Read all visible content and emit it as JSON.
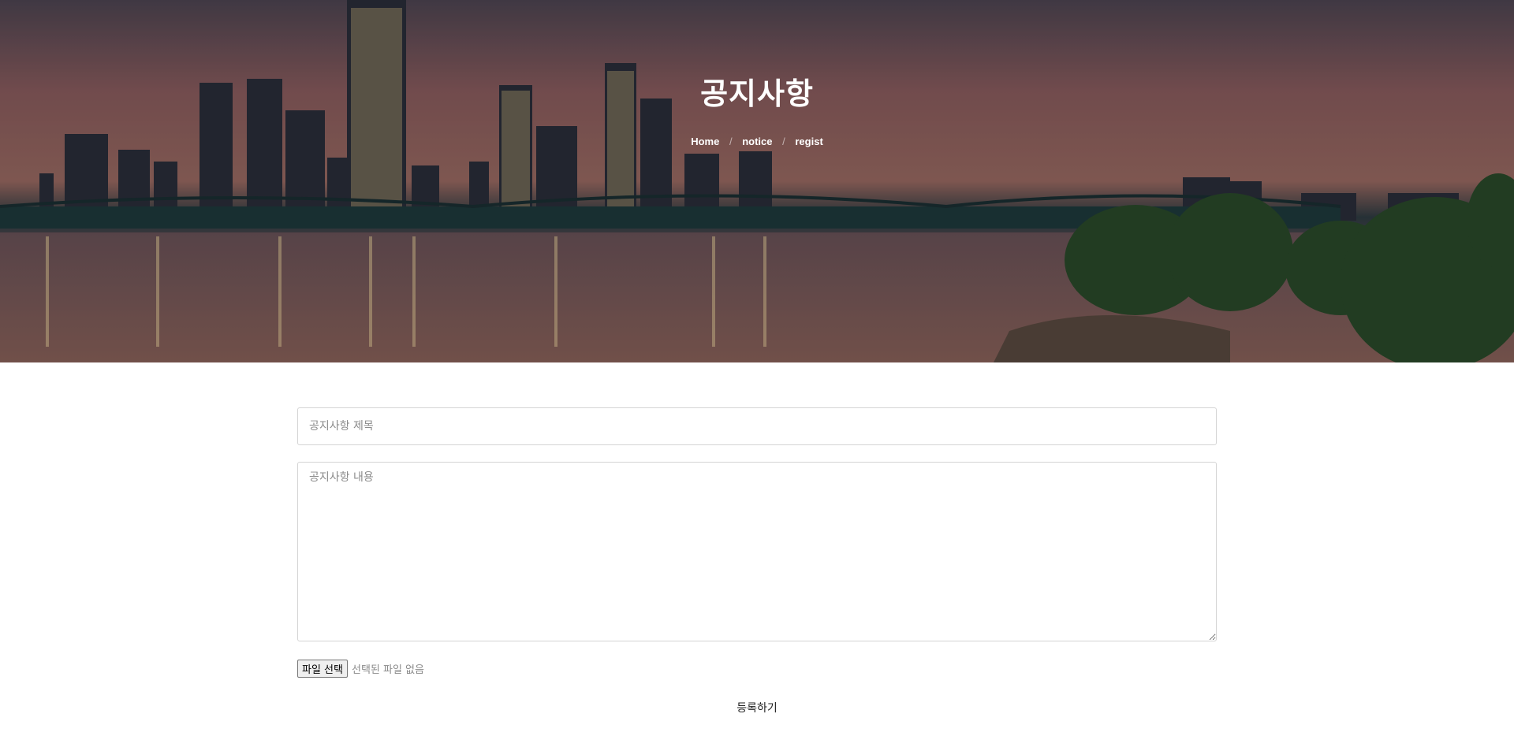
{
  "hero": {
    "title": "공지사항",
    "breadcrumb": [
      "Home",
      "notice",
      "regist"
    ]
  },
  "form": {
    "title_placeholder": "공지사항 제목",
    "title_value": "",
    "content_placeholder": "공지사항 내용",
    "content_value": "",
    "file_button_label": "파일 선택",
    "file_status": "선택된 파일 없음",
    "submit_label": "등록하기"
  }
}
